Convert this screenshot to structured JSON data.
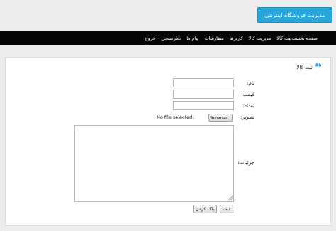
{
  "brand": {
    "label": "مدیریت فروشگاه اینترنتی"
  },
  "nav": {
    "items": [
      {
        "label": "صفحه نخست"
      },
      {
        "label": "ثبت کالا"
      },
      {
        "label": "مدیریت کالا"
      },
      {
        "label": "کاربرها"
      },
      {
        "label": "سفارشات"
      },
      {
        "label": "پیام ها"
      },
      {
        "label": "نظرسنجی"
      },
      {
        "label": "خروج"
      }
    ]
  },
  "panel": {
    "title": "ثبت کالا",
    "icon": "quote-icon",
    "accent": "#2a8fd6"
  },
  "form": {
    "name_label": "نام:",
    "name_value": "",
    "price_label": "قیمت:",
    "price_value": "",
    "count_label": "تعداد:",
    "count_value": "",
    "image_label": "تصویر:",
    "file_status": "No file selected.",
    "browse_label": "Browse...",
    "details_label": "جزئیات:",
    "submit_label": "ثبت",
    "reset_label": "پاک کردن"
  }
}
